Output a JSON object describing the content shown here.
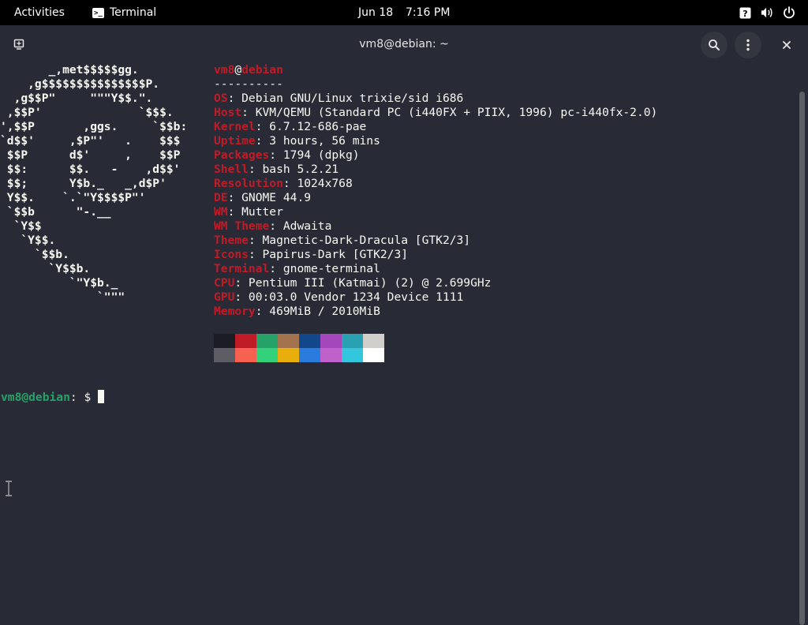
{
  "topbar": {
    "activities": "Activities",
    "app_name": "Terminal",
    "app_icon_glyph": ">_",
    "date": "Jun 18",
    "time": "7:16 PM",
    "tray_icons": [
      "help-icon",
      "volume-icon",
      "power-icon"
    ]
  },
  "window": {
    "title": "vm8@debian: ~",
    "buttons": [
      "new-tab-icon",
      "search-icon",
      "menu-icon",
      "close-icon"
    ]
  },
  "logo_lines": [
    "       _,met$$$$$gg.",
    "    ,g$$$$$$$$$$$$$$$P.",
    "  ,g$$P\"     \"\"\"Y$$.\".",
    " ,$$P'              `$$$.",
    "',$$P       ,ggs.     `$$b:",
    "`d$$'     ,$P\"'   .    $$$",
    " $$P      d$'     ,    $$P",
    " $$:      $$.   -    ,d$$'",
    " $$;      Y$b._   _,d$P'",
    " Y$$.    `.`\"Y$$$$P\"'",
    " `$$b      \"-.__",
    "  `Y$$",
    "   `Y$$.",
    "     `$$b.",
    "       `Y$$b.",
    "          `\"Y$b._",
    "              `\"\"\""
  ],
  "fetch": {
    "user": "vm8",
    "at": "@",
    "host": "debian",
    "separator": "----------",
    "rows": [
      {
        "label": "OS",
        "value": ": Debian GNU/Linux trixie/sid i686"
      },
      {
        "label": "Host",
        "value": ": KVM/QEMU (Standard PC (i440FX + PIIX, 1996) pc-i440fx-2.0)"
      },
      {
        "label": "Kernel",
        "value": ": 6.7.12-686-pae"
      },
      {
        "label": "Uptime",
        "value": ": 3 hours, 56 mins"
      },
      {
        "label": "Packages",
        "value": ": 1794 (dpkg)"
      },
      {
        "label": "Shell",
        "value": ": bash 5.2.21"
      },
      {
        "label": "Resolution",
        "value": ": 1024x768"
      },
      {
        "label": "DE",
        "value": ": GNOME 44.9"
      },
      {
        "label": "WM",
        "value": ": Mutter"
      },
      {
        "label": "WM Theme",
        "value": ": Adwaita"
      },
      {
        "label": "Theme",
        "value": ": Magnetic-Dark-Dracula [GTK2/3]"
      },
      {
        "label": "Icons",
        "value": ": Papirus-Dark [GTK2/3]"
      },
      {
        "label": "Terminal",
        "value": ": gnome-terminal"
      },
      {
        "label": "CPU",
        "value": ": Pentium III (Katmai) (2) @ 2.699GHz"
      },
      {
        "label": "GPU",
        "value": ": 00:03.0 Vendor 1234 Device 1111"
      },
      {
        "label": "Memory",
        "value": ": 469MiB / 2010MiB"
      }
    ],
    "palette_top": [
      "#1c1c24",
      "#c01c28",
      "#26a269",
      "#a2734c",
      "#12488b",
      "#a347ba",
      "#2aa1b3",
      "#d0cfcc"
    ],
    "palette_bottom": [
      "#5e5c64",
      "#f66151",
      "#33d17a",
      "#e9ad0c",
      "#2a7bde",
      "#c061cb",
      "#33c7de",
      "#ffffff"
    ]
  },
  "prompt": {
    "userhost": "vm8@debian",
    "suffix": ": $ "
  },
  "colors": {
    "background": "#282a36",
    "accent_red": "#c01c28",
    "accent_green": "#26a269"
  }
}
